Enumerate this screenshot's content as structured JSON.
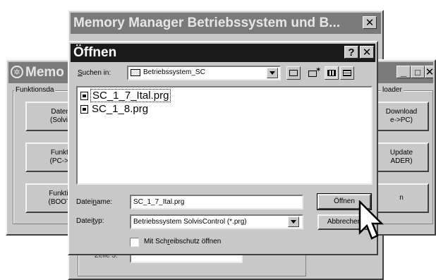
{
  "window_back": {
    "title": "Memory Manager Betriebssystem und B...",
    "close_glyph": "✕",
    "field_label": "Zeile 3:"
  },
  "window_left": {
    "title": "Memo",
    "group_label": "Funktionsda",
    "buttons": [
      {
        "label": "Datensp\n(Solvis H"
      },
      {
        "label": "Funktion\n(PC->BO"
      },
      {
        "label": "Funktions\n(BOOTLO"
      }
    ],
    "right_group_label": "loader",
    "right_buttons": [
      {
        "label": "Download\ne->PC)"
      },
      {
        "label": "Update\nADER)"
      },
      {
        "label": "n"
      }
    ],
    "min_glyph": "_",
    "max_glyph": "□",
    "close_glyph": "✕"
  },
  "dialog": {
    "title": "Öffnen",
    "help_glyph": "?",
    "close_glyph": "✕",
    "look_in": {
      "label_prefix": "",
      "label_accel": "S",
      "label_rest": "uchen in:",
      "value": "Betriebssystem_SC"
    },
    "files": [
      {
        "name": "SC_1_7_Ital.prg",
        "selected": true
      },
      {
        "name": "SC_1_8.prg",
        "selected": false
      }
    ],
    "filename": {
      "label_prefix": "Datei",
      "label_accel": "n",
      "label_rest": "ame:",
      "value": "SC_1_7_Ital.prg"
    },
    "filetype": {
      "label_prefix": "Datei",
      "label_accel": "t",
      "label_rest": "yp:",
      "value": "Betriebssystem SolvisControl (*.prg)"
    },
    "open_button": "Öffnen",
    "cancel_button": "Abbrechen",
    "readonly": {
      "label_prefix": "Mit Sch",
      "label_accel": "r",
      "label_rest": "eibschutz öffnen",
      "checked": false
    }
  },
  "icons": {
    "folder": "folder-icon",
    "up_folder": "up-folder-icon",
    "new_folder": "new-folder-icon",
    "list_view": "list-view-icon",
    "details_view": "details-view-icon",
    "cursor": "mouse-pointer-icon",
    "app": "memory-manager-app-icon"
  }
}
